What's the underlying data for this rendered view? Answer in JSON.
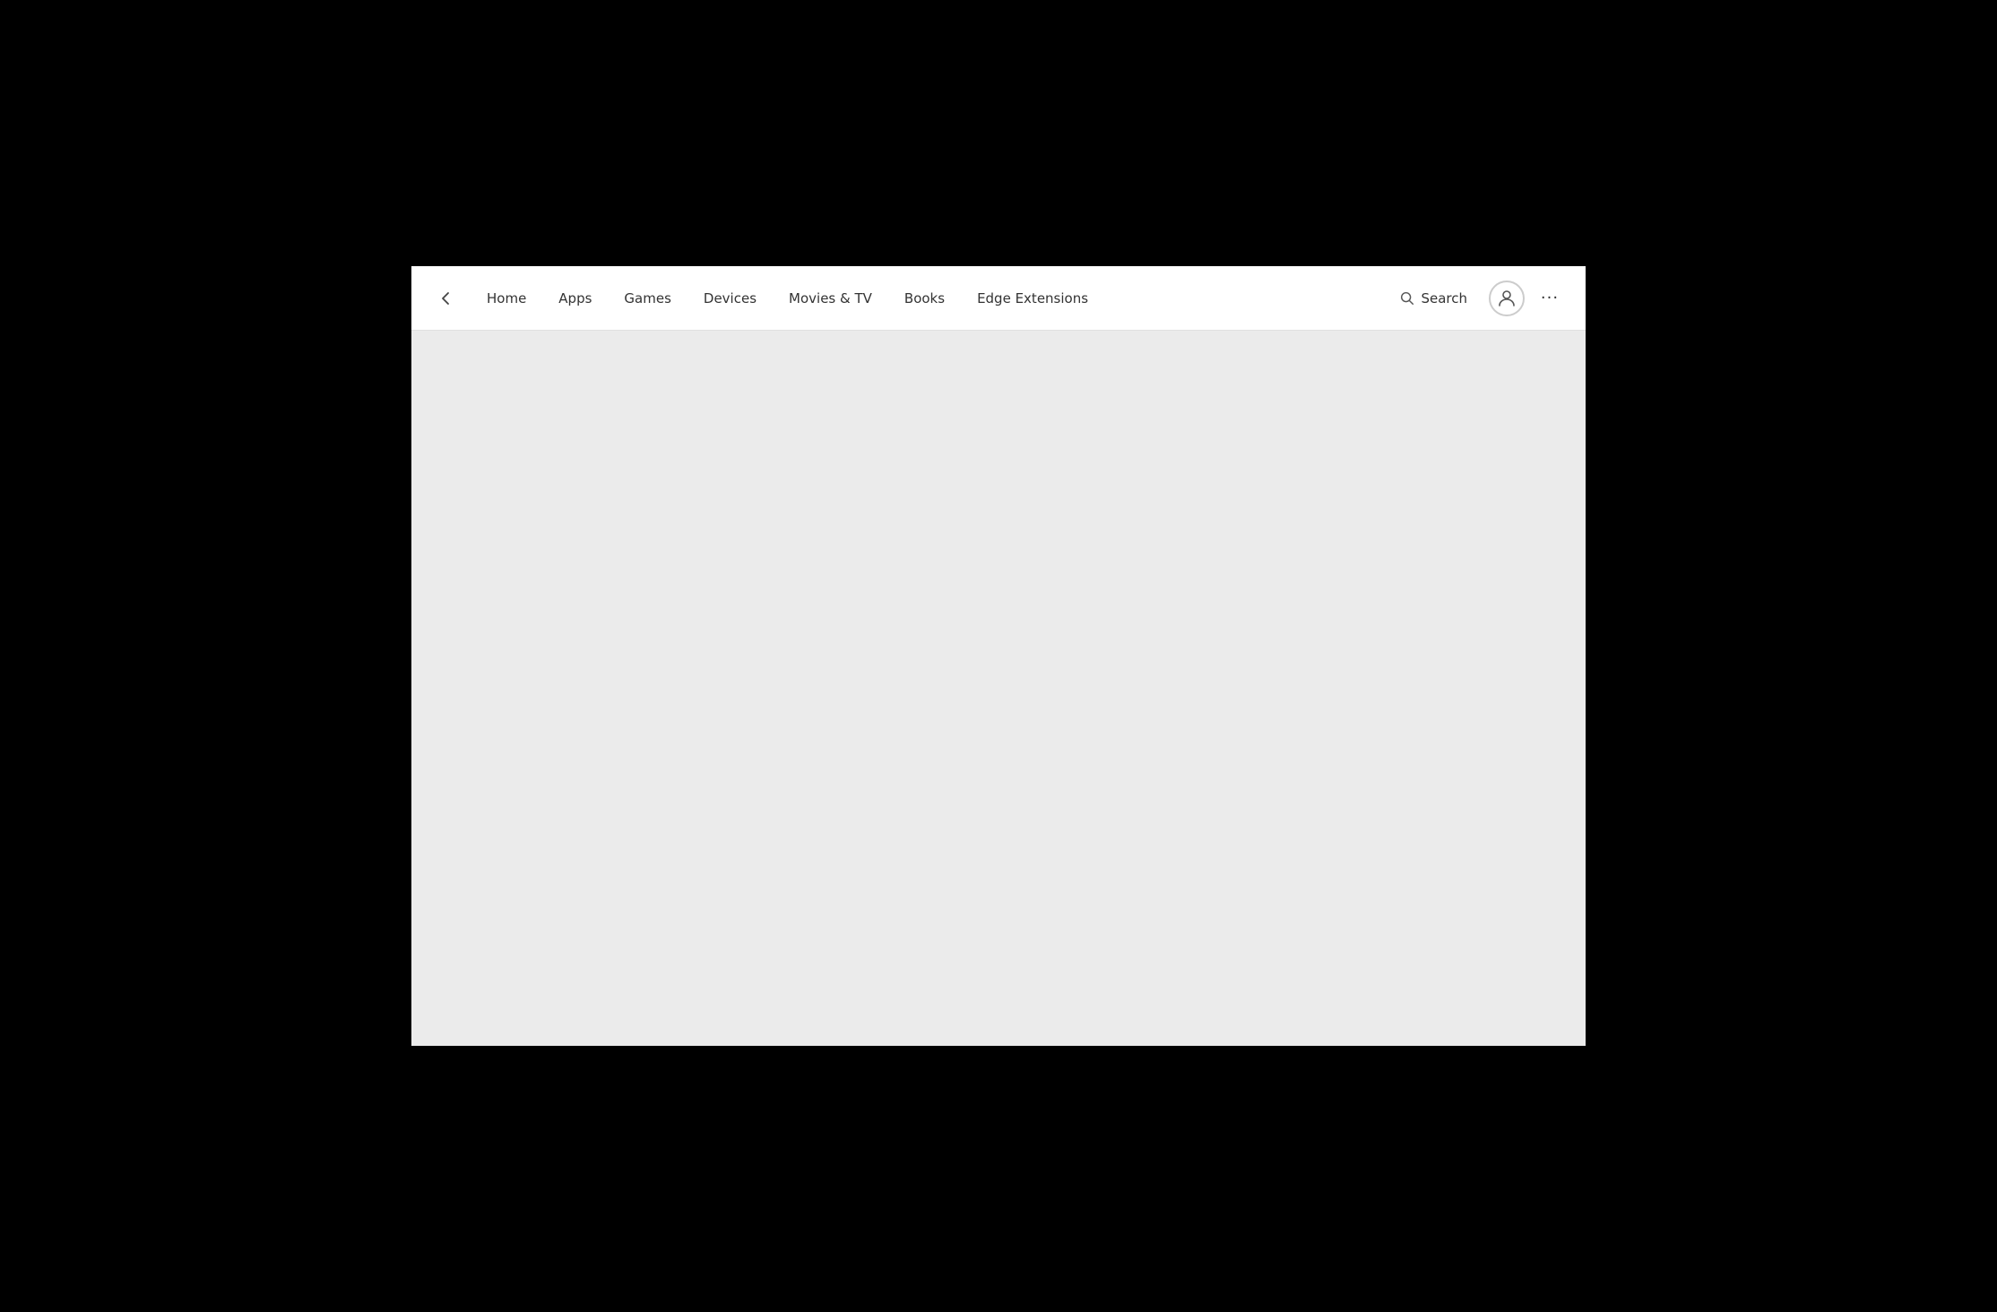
{
  "window": {
    "background": "#ebebeb"
  },
  "nav": {
    "back_label": "Back",
    "items": [
      {
        "id": "home",
        "label": "Home"
      },
      {
        "id": "apps",
        "label": "Apps"
      },
      {
        "id": "games",
        "label": "Games"
      },
      {
        "id": "devices",
        "label": "Devices"
      },
      {
        "id": "movies-tv",
        "label": "Movies & TV"
      },
      {
        "id": "books",
        "label": "Books"
      },
      {
        "id": "edge-extensions",
        "label": "Edge Extensions"
      }
    ]
  },
  "toolbar": {
    "search_label": "Search",
    "more_label": "···"
  },
  "icons": {
    "back": "←",
    "search": "search-icon",
    "account": "account-icon",
    "more": "more-icon"
  }
}
